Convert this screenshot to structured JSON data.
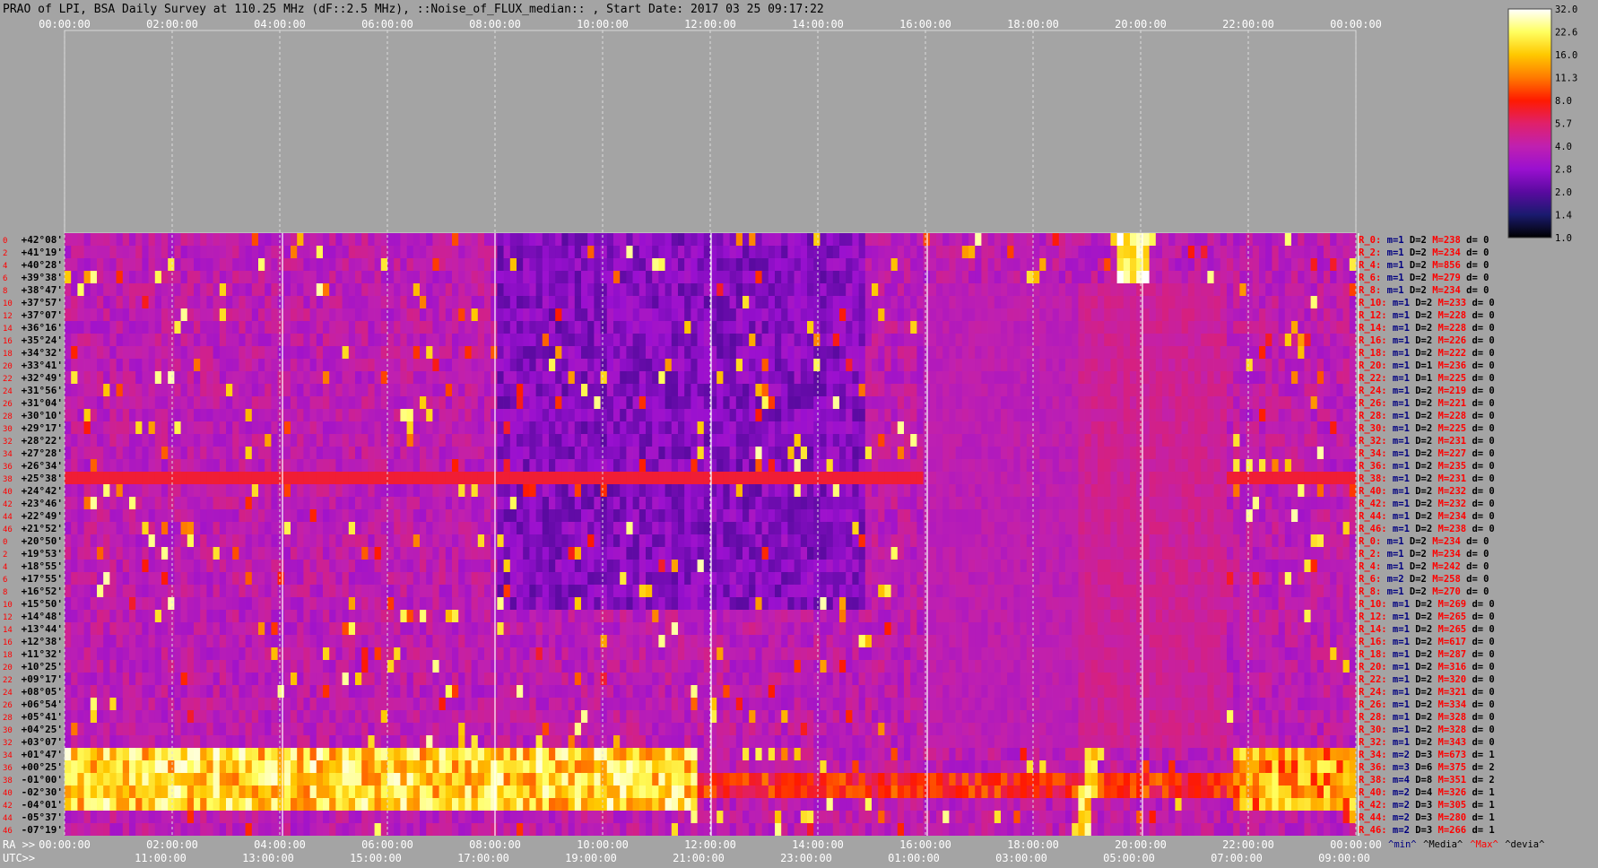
{
  "chart_data": {
    "type": "heatmap",
    "title": "PRAO of LPI, BSA Daily Survey at 110.25 MHz (dF::2.5 MHz), ::Noise_of_FLUX_median:: , Start Date: 2017 03 25 09:17:22",
    "top_axis_ticks": [
      "00:00:00",
      "02:00:00",
      "04:00:00",
      "06:00:00",
      "08:00:00",
      "10:00:00",
      "12:00:00",
      "14:00:00",
      "16:00:00",
      "18:00:00",
      "20:00:00",
      "22:00:00",
      "00:00:00"
    ],
    "ra_axis_label": "RA >>",
    "ra_axis_ticks": [
      "00:00:00",
      "02:00:00",
      "04:00:00",
      "06:00:00",
      "08:00:00",
      "10:00:00",
      "12:00:00",
      "14:00:00",
      "16:00:00",
      "18:00:00",
      "20:00:00",
      "22:00:00",
      "00:00:00"
    ],
    "utc_axis_label": "UTC>>",
    "utc_axis_ticks": [
      "11:00:00",
      "13:00:00",
      "15:00:00",
      "17:00:00",
      "19:00:00",
      "21:00:00",
      "23:00:00",
      "01:00:00",
      "03:00:00",
      "05:00:00",
      "07:00:00",
      "09:00:00"
    ],
    "row_indices": [
      "0",
      "2",
      "4",
      "6",
      "8",
      "10",
      "12",
      "14",
      "16",
      "18",
      "20",
      "22",
      "24",
      "26",
      "28",
      "30",
      "32",
      "34",
      "36",
      "38",
      "40",
      "42",
      "44",
      "46",
      "0",
      "2",
      "4",
      "6",
      "8",
      "10",
      "12",
      "14",
      "16",
      "18",
      "20",
      "22",
      "24",
      "26",
      "28",
      "30",
      "32",
      "34",
      "36",
      "38",
      "40",
      "42",
      "44",
      "46"
    ],
    "declinations": [
      "+42°08'",
      "+41°19'",
      "+40°28'",
      "+39°38'",
      "+38°47'",
      "+37°57'",
      "+37°07'",
      "+36°16'",
      "+35°24'",
      "+34°32'",
      "+33°41'",
      "+32°49'",
      "+31°56'",
      "+31°04'",
      "+30°10'",
      "+29°17'",
      "+28°22'",
      "+27°28'",
      "+26°34'",
      "+25°38'",
      "+24°42'",
      "+23°46'",
      "+22°49'",
      "+21°52'",
      "+20°50'",
      "+19°53'",
      "+18°55'",
      "+17°55'",
      "+16°52'",
      "+15°50'",
      "+14°48'",
      "+13°44'",
      "+12°38'",
      "+11°32'",
      "+10°25'",
      "+09°17'",
      "+08°05'",
      "+06°54'",
      "+05°41'",
      "+04°25'",
      "+03°07'",
      "+01°47'",
      "+00°25'",
      "-01°00'",
      "-02°30'",
      "-04°01'",
      "-05°37'",
      "-07°19'"
    ],
    "row_stats": [
      {
        "r": "R_0:",
        "m": "m=1",
        "d": "D=2",
        "mx": "M=238",
        "dv": "d= 0"
      },
      {
        "r": "R_2:",
        "m": "m=1",
        "d": "D=2",
        "mx": "M=234",
        "dv": "d= 0"
      },
      {
        "r": "R_4:",
        "m": "m=1",
        "d": "D=2",
        "mx": "M=856",
        "dv": "d= 0"
      },
      {
        "r": "R_6:",
        "m": "m=1",
        "d": "D=2",
        "mx": "M=279",
        "dv": "d= 0"
      },
      {
        "r": "R_8:",
        "m": "m=1",
        "d": "D=2",
        "mx": "M=234",
        "dv": "d= 0"
      },
      {
        "r": "R_10:",
        "m": "m=1",
        "d": "D=2",
        "mx": "M=233",
        "dv": "d= 0"
      },
      {
        "r": "R_12:",
        "m": "m=1",
        "d": "D=2",
        "mx": "M=228",
        "dv": "d= 0"
      },
      {
        "r": "R_14:",
        "m": "m=1",
        "d": "D=2",
        "mx": "M=228",
        "dv": "d= 0"
      },
      {
        "r": "R_16:",
        "m": "m=1",
        "d": "D=2",
        "mx": "M=226",
        "dv": "d= 0"
      },
      {
        "r": "R_18:",
        "m": "m=1",
        "d": "D=2",
        "mx": "M=222",
        "dv": "d= 0"
      },
      {
        "r": "R_20:",
        "m": "m=1",
        "d": "D=1",
        "mx": "M=236",
        "dv": "d= 0"
      },
      {
        "r": "R_22:",
        "m": "m=1",
        "d": "D=1",
        "mx": "M=225",
        "dv": "d= 0"
      },
      {
        "r": "R_24:",
        "m": "m=1",
        "d": "D=2",
        "mx": "M=219",
        "dv": "d= 0"
      },
      {
        "r": "R_26:",
        "m": "m=1",
        "d": "D=2",
        "mx": "M=221",
        "dv": "d= 0"
      },
      {
        "r": "R_28:",
        "m": "m=1",
        "d": "D=2",
        "mx": "M=228",
        "dv": "d= 0"
      },
      {
        "r": "R_30:",
        "m": "m=1",
        "d": "D=2",
        "mx": "M=225",
        "dv": "d= 0"
      },
      {
        "r": "R_32:",
        "m": "m=1",
        "d": "D=2",
        "mx": "M=231",
        "dv": "d= 0"
      },
      {
        "r": "R_34:",
        "m": "m=1",
        "d": "D=2",
        "mx": "M=227",
        "dv": "d= 0"
      },
      {
        "r": "R_36:",
        "m": "m=1",
        "d": "D=2",
        "mx": "M=235",
        "dv": "d= 0"
      },
      {
        "r": "R_38:",
        "m": "m=1",
        "d": "D=2",
        "mx": "M=231",
        "dv": "d= 0"
      },
      {
        "r": "R_40:",
        "m": "m=1",
        "d": "D=2",
        "mx": "M=232",
        "dv": "d= 0"
      },
      {
        "r": "R_42:",
        "m": "m=1",
        "d": "D=2",
        "mx": "M=232",
        "dv": "d= 0"
      },
      {
        "r": "R_44:",
        "m": "m=1",
        "d": "D=2",
        "mx": "M=234",
        "dv": "d= 0"
      },
      {
        "r": "R_46:",
        "m": "m=1",
        "d": "D=2",
        "mx": "M=238",
        "dv": "d= 0"
      },
      {
        "r": "R_0:",
        "m": "m=1",
        "d": "D=2",
        "mx": "M=234",
        "dv": "d= 0"
      },
      {
        "r": "R_2:",
        "m": "m=1",
        "d": "D=2",
        "mx": "M=234",
        "dv": "d= 0"
      },
      {
        "r": "R_4:",
        "m": "m=1",
        "d": "D=2",
        "mx": "M=242",
        "dv": "d= 0"
      },
      {
        "r": "R_6:",
        "m": "m=2",
        "d": "D=2",
        "mx": "M=258",
        "dv": "d= 0"
      },
      {
        "r": "R_8:",
        "m": "m=1",
        "d": "D=2",
        "mx": "M=270",
        "dv": "d= 0"
      },
      {
        "r": "R_10:",
        "m": "m=1",
        "d": "D=2",
        "mx": "M=269",
        "dv": "d= 0"
      },
      {
        "r": "R_12:",
        "m": "m=1",
        "d": "D=2",
        "mx": "M=265",
        "dv": "d= 0"
      },
      {
        "r": "R_14:",
        "m": "m=1",
        "d": "D=2",
        "mx": "M=265",
        "dv": "d= 0"
      },
      {
        "r": "R_16:",
        "m": "m=1",
        "d": "D=2",
        "mx": "M=617",
        "dv": "d= 0"
      },
      {
        "r": "R_18:",
        "m": "m=1",
        "d": "D=2",
        "mx": "M=287",
        "dv": "d= 0"
      },
      {
        "r": "R_20:",
        "m": "m=1",
        "d": "D=2",
        "mx": "M=316",
        "dv": "d= 0"
      },
      {
        "r": "R_22:",
        "m": "m=1",
        "d": "D=2",
        "mx": "M=320",
        "dv": "d= 0"
      },
      {
        "r": "R_24:",
        "m": "m=1",
        "d": "D=2",
        "mx": "M=321",
        "dv": "d= 0"
      },
      {
        "r": "R_26:",
        "m": "m=1",
        "d": "D=2",
        "mx": "M=334",
        "dv": "d= 0"
      },
      {
        "r": "R_28:",
        "m": "m=1",
        "d": "D=2",
        "mx": "M=328",
        "dv": "d= 0"
      },
      {
        "r": "R_30:",
        "m": "m=1",
        "d": "D=2",
        "mx": "M=328",
        "dv": "d= 0"
      },
      {
        "r": "R_32:",
        "m": "m=1",
        "d": "D=2",
        "mx": "M=343",
        "dv": "d= 0"
      },
      {
        "r": "R_34:",
        "m": "m=2",
        "d": "D=3",
        "mx": "M=673",
        "dv": "d= 1"
      },
      {
        "r": "R_36:",
        "m": "m=3",
        "d": "D=6",
        "mx": "M=375",
        "dv": "d= 2"
      },
      {
        "r": "R_38:",
        "m": "m=4",
        "d": "D=8",
        "mx": "M=351",
        "dv": "d= 2"
      },
      {
        "r": "R_40:",
        "m": "m=2",
        "d": "D=4",
        "mx": "M=326",
        "dv": "d= 1"
      },
      {
        "r": "R_42:",
        "m": "m=2",
        "d": "D=3",
        "mx": "M=305",
        "dv": "d= 1"
      },
      {
        "r": "R_44:",
        "m": "m=2",
        "d": "D=3",
        "mx": "M=280",
        "dv": "d= 1"
      },
      {
        "r": "R_46:",
        "m": "m=2",
        "d": "D=3",
        "mx": "M=266",
        "dv": "d= 1"
      }
    ],
    "stats_footer": [
      "^min^",
      "^Media^",
      "^Max^",
      "^devia^"
    ],
    "colorbar_ticks": [
      "32.0",
      "22.6",
      "16.0",
      "11.3",
      "8.0",
      "5.7",
      "4.0",
      "2.8",
      "2.0",
      "1.4",
      "1.0"
    ],
    "colormap_colors": [
      "#000000",
      "#1a1a6e",
      "#5a0aa0",
      "#9a10d0",
      "#c020b0",
      "#e0206a",
      "#ff1a00",
      "#ff7a00",
      "#ffc800",
      "#ffff60",
      "#ffffff"
    ],
    "colors": {
      "background": "#a4a4a4",
      "title_text": "#000000",
      "tick_text": "#ffffff",
      "label_red": "#ff0000",
      "label_blue": "#000080"
    }
  }
}
